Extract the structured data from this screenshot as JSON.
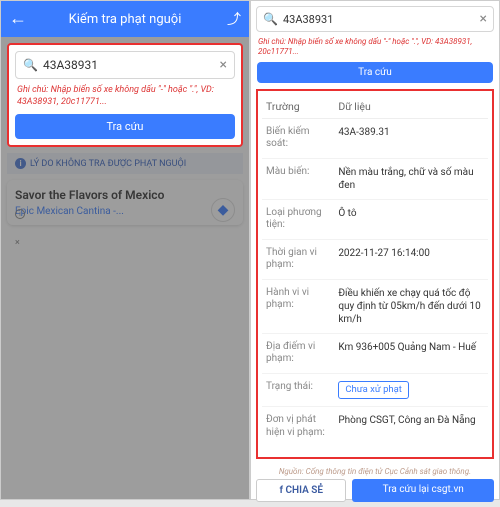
{
  "header": {
    "title": "Kiếm tra phạt nguội"
  },
  "search": {
    "value": "43A38931",
    "note": "Ghi chú: Nhập biển số xe không dấu \"-\" hoặc \".\", VD: 43A38931, 20c11771...",
    "button": "Tra cứu"
  },
  "explain": "LÝ DO KHÔNG TRA ĐƯỢC PHẠT NGUỘI",
  "ad": {
    "title": "Savor the Flavors of Mexico",
    "subtitle": "Epic Mexican Cantina -..."
  },
  "right": {
    "search_value": "43A38931",
    "note": "Ghi chú: Nhập biển số xe không dấu \"-\" hoặc \".\", VD: 43A38931, 20c11771...",
    "button": "Tra cứu"
  },
  "table": {
    "hdr_field": "Trường",
    "hdr_data": "Dữ liệu",
    "rows": {
      "plate_l": "Biến kiếm soát:",
      "plate_v": "43A-389.31",
      "color_l": "Màu biến:",
      "color_v": "Nền màu trắng, chữ và số màu đen",
      "type_l": "Loại phương tiện:",
      "type_v": "Ô tô",
      "time_l": "Thời gian vi phạm:",
      "time_v": "2022-11-27 16:14:00",
      "act_l": "Hành vi vi phạm:",
      "act_v": "Điều khiến xe chạy quá tốc độ quy định từ 05km/h đến dưới 10 km/h",
      "loc_l": "Địa điếm vi phạm:",
      "loc_v": "Km 936+005 Quảng Nam - Huế",
      "status_l": "Trạng thái:",
      "status_v": "Chưa xử phạt",
      "unit_l": "Đơn vị phát hiện vi phạm:",
      "unit_v": "Phòng CSGT, Công an  Đà Nẵng"
    }
  },
  "source": "Nguồn: Cổng thông tin điện tử Cục Cảnh sát giao thông.",
  "actions": {
    "share": "CHIA SẺ",
    "again": "Tra cứu lại csgt.vn"
  }
}
